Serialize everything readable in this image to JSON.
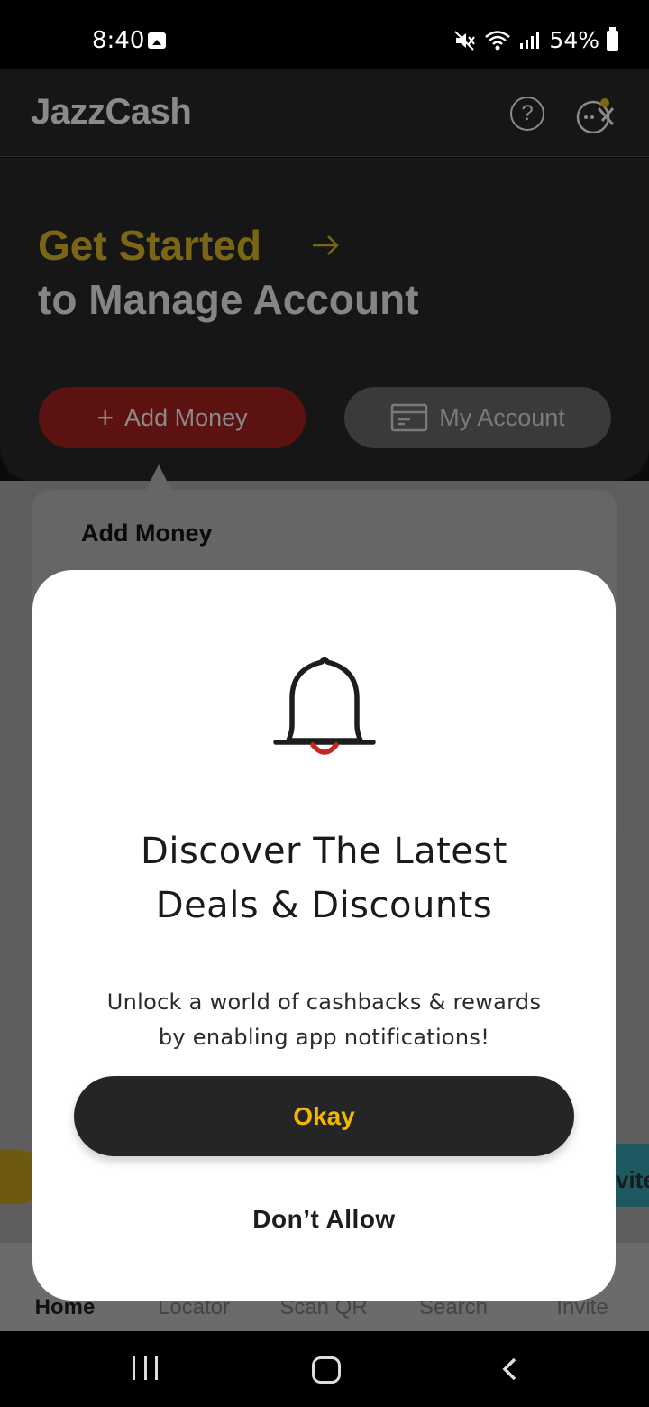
{
  "status_bar": {
    "time": "8:40",
    "battery": "54%",
    "icons": [
      "image-icon",
      "mute-icon",
      "wifi-icon",
      "signal-icon",
      "battery-icon"
    ]
  },
  "header": {
    "logo": "JazzCash",
    "help_icon": "?"
  },
  "hero": {
    "line1": "Get Started",
    "line2": "to Manage Account",
    "add_money": "Add Money",
    "add_money_icon": "+",
    "my_account": "My Account"
  },
  "tooltip": {
    "title": "Add Money"
  },
  "peek": {
    "right_card_text": "vite"
  },
  "bottom_nav": {
    "items": [
      "Home",
      "Locator",
      "Scan QR",
      "Search",
      "Invite"
    ],
    "active": "Home"
  },
  "modal": {
    "title_line1": "Discover The Latest",
    "title_line2": "Deals & Discounts",
    "body_line1": "Unlock a world of cashbacks & rewards",
    "body_line2": "by enabling app notifications!",
    "okay": "Okay",
    "deny": "Don’t Allow"
  },
  "colors": {
    "brand_yellow": "#f2b800",
    "brand_red": "#c4281f",
    "dark": "#252525",
    "dim_overlay": "#5e5e5e"
  }
}
